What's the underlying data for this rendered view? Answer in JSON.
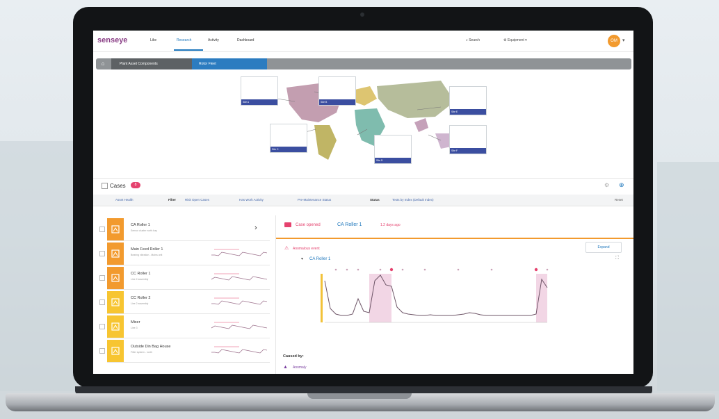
{
  "app": {
    "logo": "senseye"
  },
  "nav": [
    {
      "label": "Like"
    },
    {
      "label": "Research"
    },
    {
      "label": "Activity"
    },
    {
      "label": "Dashboard"
    }
  ],
  "header_right": {
    "search": "Search",
    "filters": "Equipment",
    "avatar_initials": "OM"
  },
  "breadcrumb": {
    "item1": "Plant Asset Components",
    "item2": "Rotor Fleet"
  },
  "map_sites": [
    {
      "label": "Site A"
    },
    {
      "label": "Site B"
    },
    {
      "label": "Site C"
    },
    {
      "label": "Site D"
    },
    {
      "label": "Site E"
    },
    {
      "label": "Site F"
    }
  ],
  "cases": {
    "title": "Cases",
    "count": "8"
  },
  "filters": {
    "group": "Asset Health",
    "filter_label": "Filter",
    "f1": "Risk Open Cases",
    "f2": "Has Work Activity",
    "f3": "Pre-Maintenance Status",
    "status_label": "Status",
    "f4": "Tests by Index (Default Index)",
    "reset": "Reset"
  },
  "case_list": [
    {
      "title": "CA Roller 1",
      "sub": "Sensor cluster north bay",
      "color": "#f29a2e"
    },
    {
      "title": "Main Feed Roller 1",
      "sub": "Bearing vibration - Mains unit",
      "color": "#f29a2e"
    },
    {
      "title": "CC Roller 1",
      "sub": "Line 2 assembly",
      "color": "#f29a2e"
    },
    {
      "title": "CC Roller 2",
      "sub": "Line 2 assembly",
      "color": "#f7c531"
    },
    {
      "title": "Mixer",
      "sub": "Line 3",
      "color": "#f7c531"
    },
    {
      "title": "Outside Din Bag House",
      "sub": "Filter system - north",
      "color": "#f7c531"
    }
  ],
  "detail": {
    "tag": "Case opened",
    "asset": "CA Roller 1",
    "time": "1.2 days ago",
    "subtitle": "Anomalous event",
    "expand": "Expand",
    "series": "CA Roller 1",
    "caused_by": "Caused by:",
    "anomaly": "Anomaly"
  },
  "chart_data": {
    "type": "line",
    "x": [
      0,
      1,
      2,
      3,
      4,
      5,
      6,
      7,
      8,
      9,
      10,
      11,
      12,
      13,
      14,
      15,
      16,
      17,
      18,
      19,
      20,
      21,
      22,
      23,
      24,
      25,
      26,
      27,
      28,
      29,
      30,
      31,
      32,
      33,
      34,
      35,
      36,
      37,
      38,
      39,
      40
    ],
    "values": [
      60,
      20,
      12,
      10,
      10,
      12,
      34,
      16,
      14,
      60,
      68,
      54,
      52,
      22,
      14,
      12,
      11,
      10,
      10,
      11,
      10,
      10,
      10,
      10,
      11,
      12,
      14,
      13,
      11,
      10,
      10,
      10,
      10,
      10,
      10,
      10,
      10,
      10,
      12,
      62,
      50
    ],
    "colors": {
      "line": "#6e5567",
      "highlight": "#e8b5cf",
      "accent": "#e5426e"
    }
  }
}
